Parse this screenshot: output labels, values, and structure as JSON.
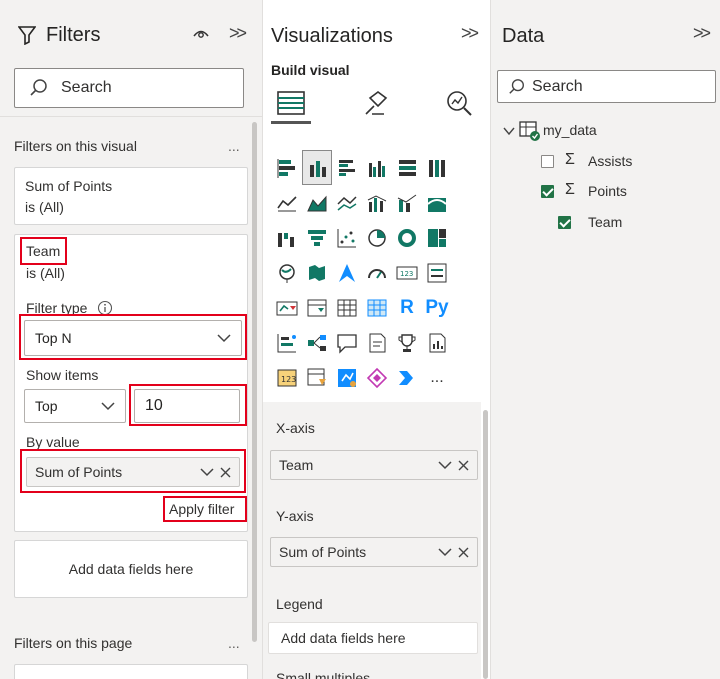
{
  "filters": {
    "title": "Filters",
    "search_placeholder": "Search",
    "section_visual": "Filters on this visual",
    "more": "...",
    "card1": {
      "field": "Sum of Points",
      "state": "is (All)"
    },
    "card2": {
      "field": "Team",
      "state": "is (All)",
      "filter_type_label": "Filter type",
      "filter_type_value": "Top N",
      "show_items_label": "Show items",
      "show_items_direction": "Top",
      "show_items_count": "10",
      "by_value_label": "By value",
      "by_value_field": "Sum of Points",
      "apply_label": "Apply filter"
    },
    "add_fields": "Add data fields here",
    "section_page": "Filters on this page"
  },
  "viz": {
    "title": "Visualizations",
    "build_visual": "Build visual",
    "icon_text": {
      "r": "R",
      "py": "Py",
      "more": "..."
    },
    "xaxis_label": "X-axis",
    "xaxis_field": "Team",
    "yaxis_label": "Y-axis",
    "yaxis_field": "Sum of Points",
    "legend_label": "Legend",
    "legend_placeholder": "Add data fields here",
    "small_multiples_label": "Small multiples"
  },
  "data_pane": {
    "title": "Data",
    "search_placeholder": "Search",
    "table_name": "my_data",
    "fields": [
      {
        "name": "Assists",
        "sigma": "Σ",
        "checked": false
      },
      {
        "name": "Points",
        "sigma": "Σ",
        "checked": true
      },
      {
        "name": "Team",
        "sigma": "",
        "checked": true
      }
    ]
  },
  "colors": {
    "highlight": "#e3001b",
    "accent": "#217346",
    "icon_teal": "#118dff"
  }
}
